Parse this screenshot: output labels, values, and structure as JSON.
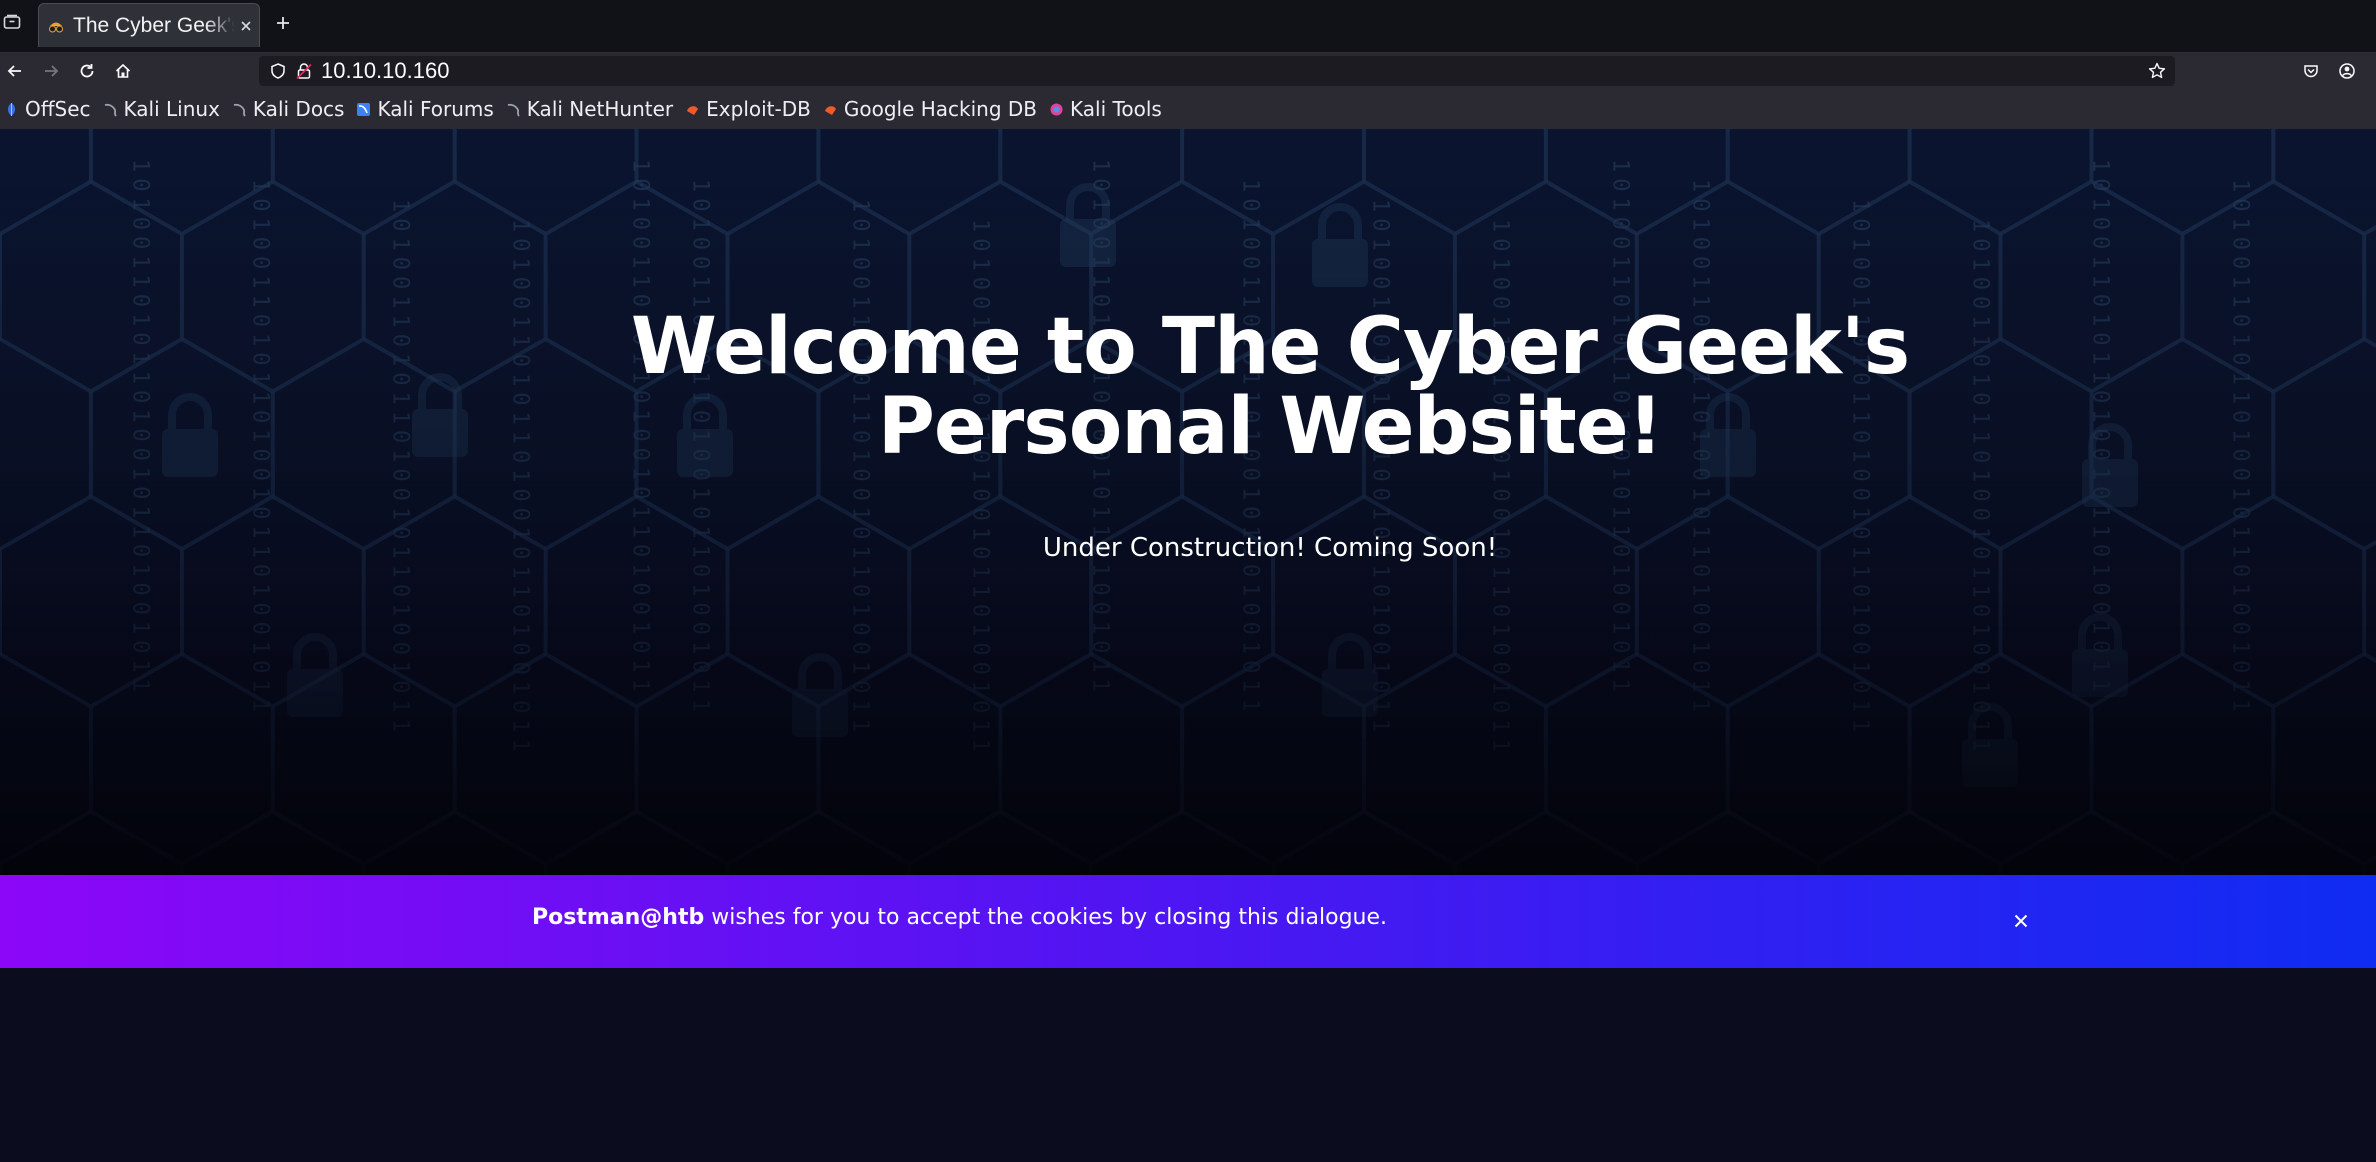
{
  "browser": {
    "tab": {
      "title": "The Cyber Geek's Personal Website",
      "favicon": "hacker-glasses-icon"
    },
    "url": "10.10.10.160",
    "bookmarks": [
      {
        "label": "OffSec",
        "icon": "offsec-icon",
        "color": "#3b6fe0"
      },
      {
        "label": "Kali Linux",
        "icon": "kali-dragon-icon",
        "color": "#9aa3ad"
      },
      {
        "label": "Kali Docs",
        "icon": "kali-dragon-icon",
        "color": "#9aa3ad"
      },
      {
        "label": "Kali Forums",
        "icon": "kali-forums-icon",
        "color": "#3b82f6"
      },
      {
        "label": "Kali NetHunter",
        "icon": "kali-dragon-icon",
        "color": "#9aa3ad"
      },
      {
        "label": "Exploit-DB",
        "icon": "exploit-db-icon",
        "color": "#ef5a28"
      },
      {
        "label": "Google Hacking DB",
        "icon": "ghdb-icon",
        "color": "#ef5a28"
      },
      {
        "label": "Kali Tools",
        "icon": "kali-tools-icon",
        "color": "#e2439a"
      }
    ]
  },
  "page": {
    "title": "Welcome to The Cyber Geek's Personal Website!",
    "subtitle": "Under Construction! Coming Soon!",
    "cookie_banner": {
      "user": "Postman@htb",
      "message": " wishes for you to accept the cookies by closing this dialogue."
    }
  },
  "colors": {
    "banner_gradient_start": "#8c07f7",
    "banner_gradient_end": "#0f2cf2",
    "page_background": "#0b0d1f"
  }
}
